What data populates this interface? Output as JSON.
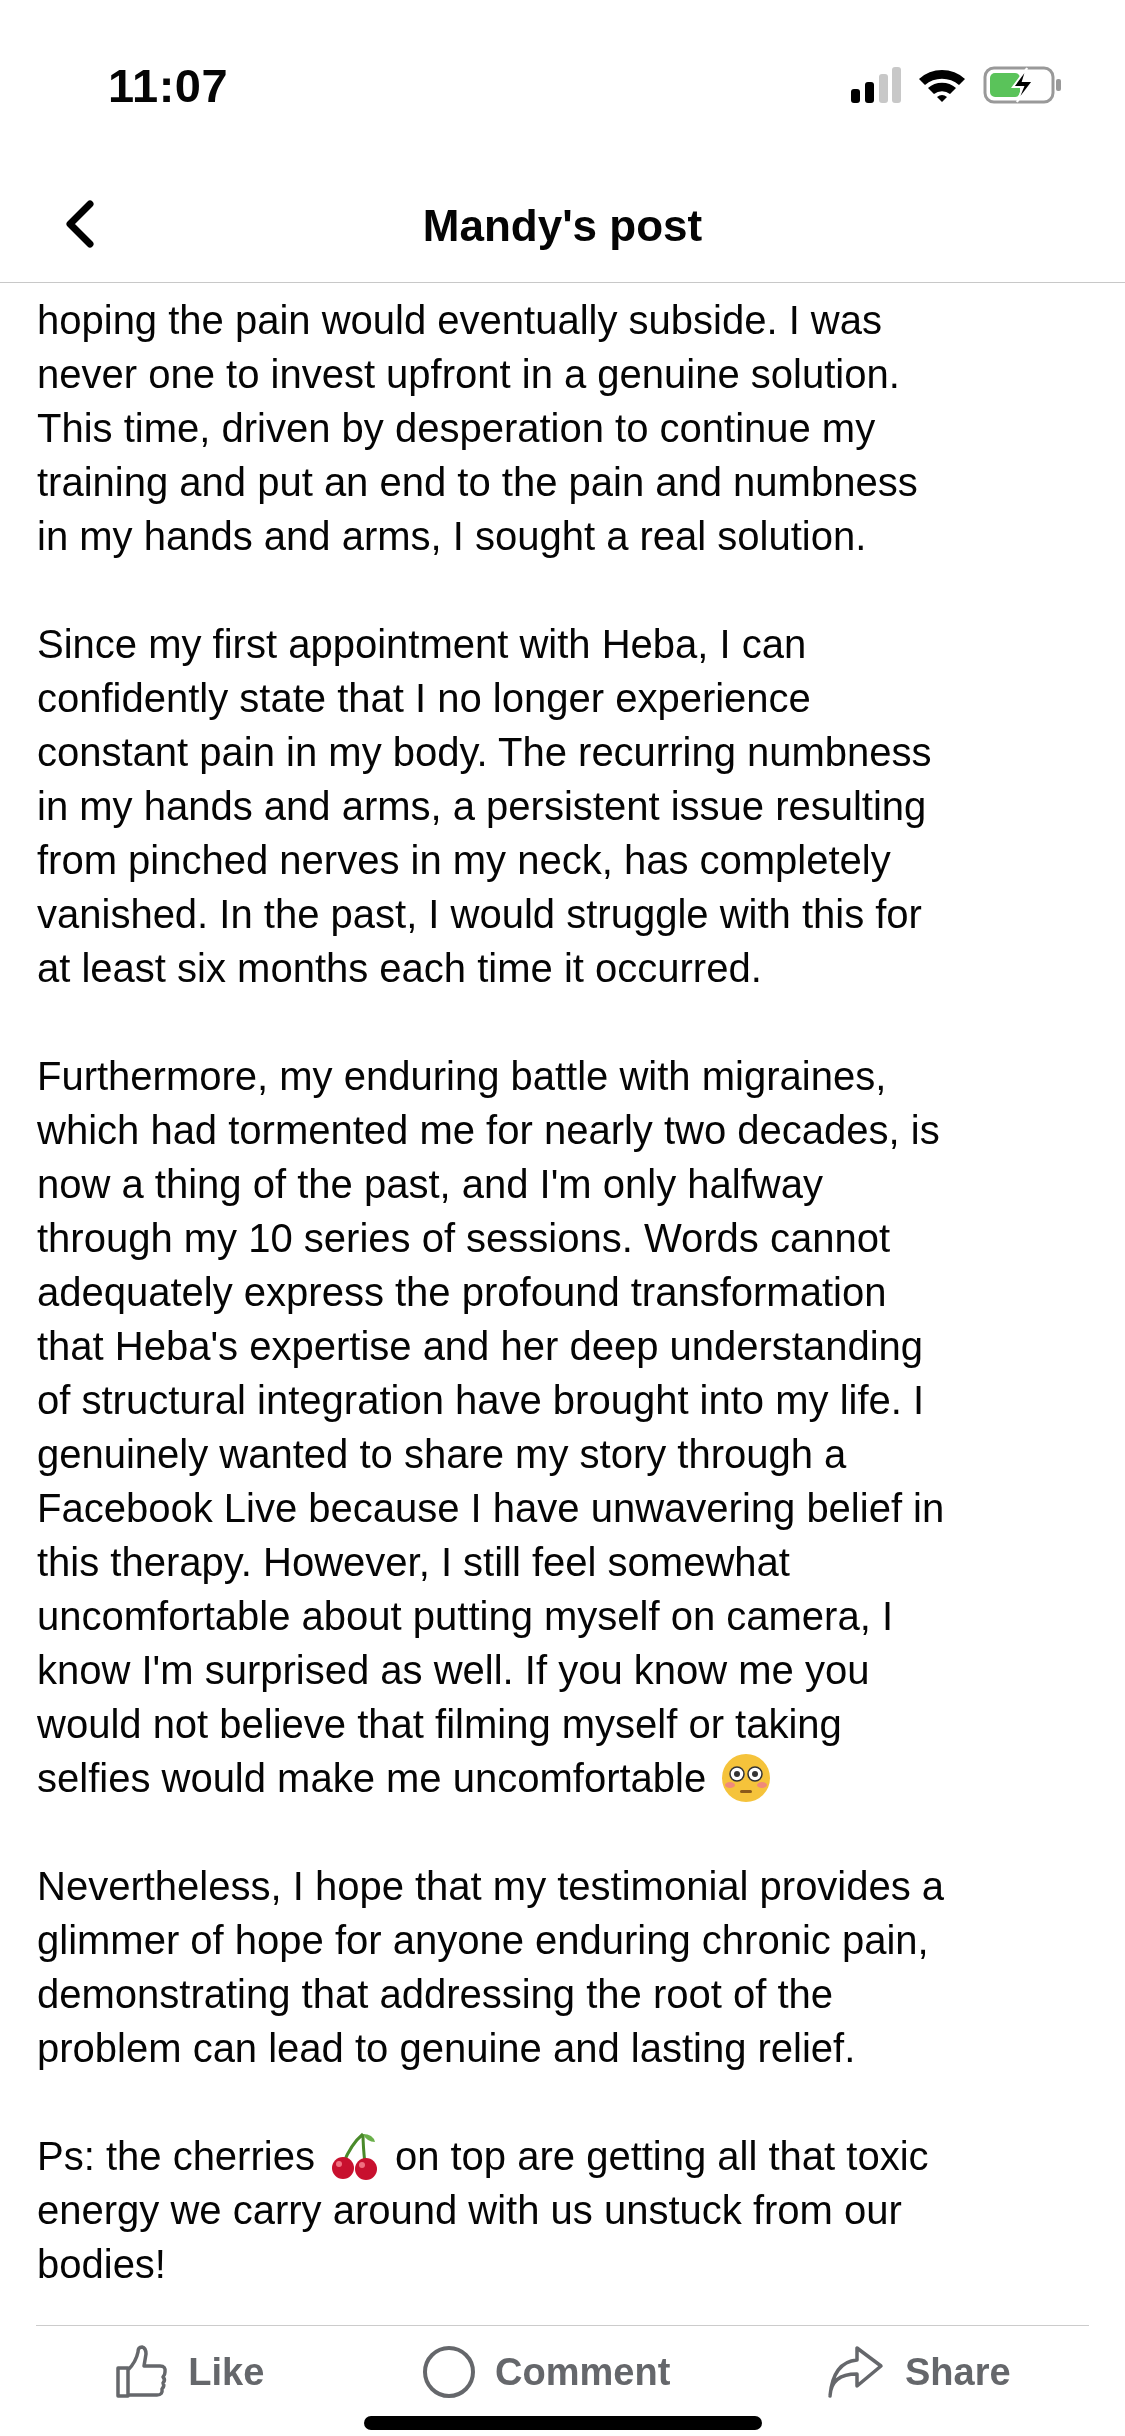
{
  "status_bar": {
    "time": "11:07"
  },
  "header": {
    "title": "Mandy's post"
  },
  "post": {
    "paragraphs": [
      [
        [
          {
            "kind": "text",
            "text": "hoping the pain would eventually subside. I was"
          }
        ],
        [
          {
            "kind": "text",
            "text": "never one to invest upfront in a genuine solution."
          }
        ],
        [
          {
            "kind": "text",
            "text": "This time, driven by desperation to continue my"
          }
        ],
        [
          {
            "kind": "text",
            "text": "training and put an end to the pain and numbness"
          }
        ],
        [
          {
            "kind": "text",
            "text": "in my hands and arms, I sought a real solution."
          }
        ]
      ],
      [
        [
          {
            "kind": "text",
            "text": "Since my first appointment with Heba, I can"
          }
        ],
        [
          {
            "kind": "text",
            "text": "confidently state that I no longer experience"
          }
        ],
        [
          {
            "kind": "text",
            "text": "constant pain in my body. The recurring numbness"
          }
        ],
        [
          {
            "kind": "text",
            "text": "in my hands and arms, a persistent issue resulting"
          }
        ],
        [
          {
            "kind": "text",
            "text": "from pinched nerves in my neck, has completely"
          }
        ],
        [
          {
            "kind": "text",
            "text": "vanished. In the past, I would struggle with this for"
          }
        ],
        [
          {
            "kind": "text",
            "text": "at least six months each time it occurred."
          }
        ]
      ],
      [
        [
          {
            "kind": "text",
            "text": "Furthermore, my enduring battle with migraines,"
          }
        ],
        [
          {
            "kind": "text",
            "text": "which had tormented me for nearly two decades, is"
          }
        ],
        [
          {
            "kind": "text",
            "text": "now a thing of the past, and I'm only halfway"
          }
        ],
        [
          {
            "kind": "text",
            "text": "through my 10 series of sessions. Words cannot"
          }
        ],
        [
          {
            "kind": "text",
            "text": "adequately express the profound transformation"
          }
        ],
        [
          {
            "kind": "text",
            "text": "that Heba's expertise and her deep understanding"
          }
        ],
        [
          {
            "kind": "text",
            "text": "of structural integration have brought into my life. I"
          }
        ],
        [
          {
            "kind": "text",
            "text": "genuinely wanted to share my story through a"
          }
        ],
        [
          {
            "kind": "text",
            "text": "Facebook Live because I have unwavering belief in"
          }
        ],
        [
          {
            "kind": "text",
            "text": "this therapy. However, I still feel somewhat"
          }
        ],
        [
          {
            "kind": "text",
            "text": "uncomfortable about putting myself on camera, I"
          }
        ],
        [
          {
            "kind": "text",
            "text": "know I'm surprised as well. If you know me you"
          }
        ],
        [
          {
            "kind": "text",
            "text": "would not believe that filming myself or taking"
          }
        ],
        [
          {
            "kind": "text",
            "text": "selfies would make me uncomfortable"
          },
          {
            "kind": "face"
          }
        ]
      ],
      [
        [
          {
            "kind": "text",
            "text": "Nevertheless, I hope that my testimonial provides a"
          }
        ],
        [
          {
            "kind": "text",
            "text": "glimmer of hope for anyone enduring chronic pain,"
          }
        ],
        [
          {
            "kind": "text",
            "text": "demonstrating that addressing the root of the"
          }
        ],
        [
          {
            "kind": "text",
            "text": "problem can lead to genuine and lasting relief."
          }
        ]
      ],
      [
        [
          {
            "kind": "text",
            "text": "Ps: the cherries"
          },
          {
            "kind": "cherries"
          },
          {
            "kind": "text",
            "text": "on top are getting all that toxic"
          }
        ],
        [
          {
            "kind": "text",
            "text": "energy we carry around with us unstuck from our"
          }
        ],
        [
          {
            "kind": "text",
            "text": "bodies!"
          }
        ]
      ]
    ]
  },
  "actions": [
    {
      "kind": "like",
      "label": "Like"
    },
    {
      "kind": "comment",
      "label": "Comment"
    },
    {
      "kind": "share",
      "label": "Share"
    }
  ]
}
